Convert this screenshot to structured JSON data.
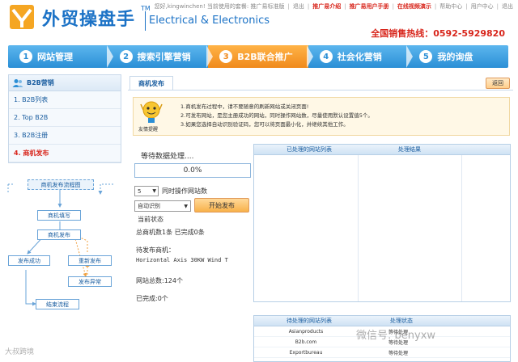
{
  "header": {
    "brand_cn": "外贸操盘手",
    "brand_tm": "TM",
    "brand_en": "Electrical & Electronics",
    "greeting": "您好,kingwinchen! 当前使用的套餐: 推广易标准版",
    "links": [
      "退出",
      "推广易介绍",
      "推广易用户手册",
      "在线视频演示",
      "帮助中心",
      "用户中心",
      "退出"
    ],
    "hotline": "全国销售热线：0592-5929820"
  },
  "steps": [
    {
      "num": "1",
      "label": "网站管理",
      "active": false
    },
    {
      "num": "2",
      "label": "搜索引擎营销",
      "active": false
    },
    {
      "num": "3",
      "label": "B2B联合推广",
      "active": true
    },
    {
      "num": "4",
      "label": "社会化营销",
      "active": false
    },
    {
      "num": "5",
      "label": "我的询盘",
      "active": false
    }
  ],
  "sidebar": {
    "title": "B2B营销",
    "items": [
      {
        "label": "1. B2B列表"
      },
      {
        "label": "2. Top B2B"
      },
      {
        "label": "3. B2B注册"
      },
      {
        "label": "4. 商机发布"
      }
    ]
  },
  "flow": {
    "title": "商机发布流程图",
    "step1": "商机填写",
    "step2": "商机发布",
    "ok": "发布成功",
    "republish": "重新发布",
    "fail": "发布异常",
    "end": "结束流程"
  },
  "main": {
    "tab": "商机发布",
    "back": "返回",
    "tips_label": "友情提醒",
    "tips": [
      "1.商机发布过程中，请不要随意的刷新网站或关闭页面!",
      "2.可发布网站，是您主册成功的网站，同时操作网站数，尽量使用默认设置值5个。",
      "3.如果您选择自动识别验证码，您可以将页面最小化，并继续其他工作。"
    ],
    "status_label": "等待数据处理....",
    "progress": "0.0%",
    "progress_value": 0.0,
    "concurrency_value": "5",
    "concurrency_label": "同时操作网站数",
    "mode_value": "自动识别",
    "start_button": "开始发布",
    "current_status": "当前状态",
    "totals": "总商机数1条  已完成0条",
    "pending_label": "待发布商机：",
    "product_name": "Horizontal Axis 30KW Wind T",
    "site_total": "网站总数:124个",
    "done_count": "已完成:0个"
  },
  "table_processed": {
    "col1": "已处理的网站列表",
    "col2": "处理结果"
  },
  "table_pending": {
    "col1": "待处理的网站列表",
    "col2": "处理状态",
    "rows": [
      {
        "site": "Asianproducts",
        "status": "等待处理"
      },
      {
        "site": "B2b.com",
        "status": "等待处理"
      },
      {
        "site": "Exportbureau",
        "status": "等待处理"
      }
    ]
  },
  "watermark": "微信号: benyxw",
  "watermark2": "大叔跨境",
  "colors": {
    "brand_blue": "#1b72c6",
    "accent_red": "#d8261c",
    "active_orange": "#f08a1c"
  }
}
